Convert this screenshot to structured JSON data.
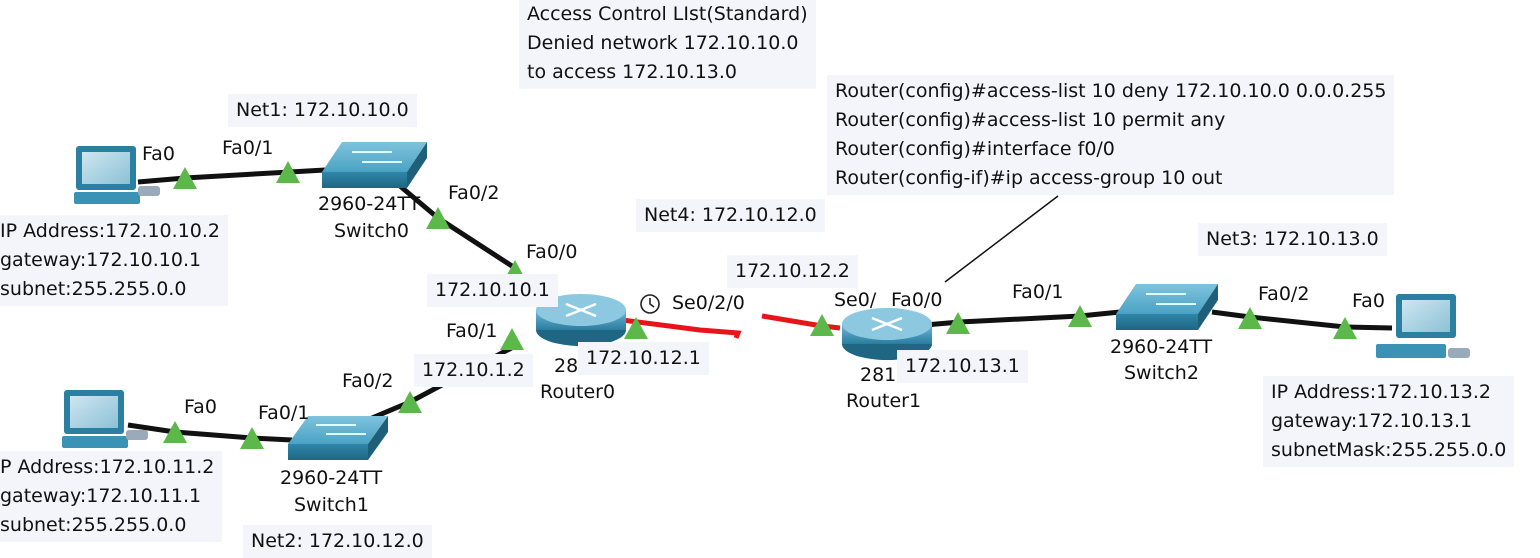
{
  "notes": {
    "acl_title": "Access Control LIst(Standard)",
    "acl_line1": "Denied network 172.10.10.0",
    "acl_line2": "to access 172.10.13.0",
    "net1": "Net1: 172.10.10.0",
    "net2": "Net2: 172.10.12.0",
    "net3": "Net3: 172.10.13.0",
    "net4": "Net4: 172.10.12.0",
    "cmd1": "Router(config)#access-list 10 deny 172.10.10.0 0.0.0.255",
    "cmd2": "Router(config)#access-list 10 permit any",
    "cmd3": "Router(config)#interface f0/0",
    "cmd4": "Router(config-if)#ip access-group 10 out",
    "pc0_ip": "IP Address:172.10.10.2",
    "pc0_gw": "gateway:172.10.10.1",
    "pc0_mask": "subnet:255.255.0.0",
    "pc1_ip": "P Address:172.10.11.2",
    "pc1_gw": "gateway:172.10.11.1",
    "pc1_mask": "subnet:255.255.0.0",
    "pc2_ip": "IP Address:172.10.13.2",
    "pc2_gw": "gateway:172.10.13.1",
    "pc2_mask": "subnetMask:255.255.0.0",
    "r0_fa00_ip": "172.10.10.1",
    "r0_fa01_ip": "172.10.1.2",
    "r0_se_ip": "172.10.12.1",
    "r1_se_ip": "172.10.12.2",
    "r1_fa00_ip": "172.10.13.1"
  },
  "devices": {
    "switch0_model": "2960-24TT",
    "switch0_name": "Switch0",
    "switch1_model": "2960-24TT",
    "switch1_name": "Switch1",
    "switch2_model": "2960-24TT",
    "switch2_name": "Switch2",
    "router0_model": "28",
    "router0_name": "Router0",
    "router1_model": "281",
    "router1_name": "Router1"
  },
  "ports": {
    "pc0_fa0": "Fa0",
    "s0_fa01": "Fa0/1",
    "s0_fa02": "Fa0/2",
    "r0_fa00": "Fa0/0",
    "r0_fa01": "Fa0/1",
    "r0_se020": "Se0/2/0",
    "r1_se0": "Se0/",
    "r1_fa00": "Fa0/0",
    "s2_fa01": "Fa0/1",
    "s2_fa02": "Fa0/2",
    "pc2_fa0": "Fa0",
    "pc1_fa0": "Fa0",
    "s1_fa01": "Fa0/1",
    "s1_fa02": "Fa0/2"
  },
  "colors": {
    "ethernet_link": "#111111",
    "serial_link": "#e8141a",
    "link_up": "#5cb84a",
    "device_blue": "#3a92b4",
    "note_bg": "#f4f5fa"
  },
  "icons": {
    "pc": "pc-icon",
    "switch": "switch-icon",
    "router": "router-icon",
    "clock": "clock-icon",
    "link_light": "triangle-up-icon"
  }
}
